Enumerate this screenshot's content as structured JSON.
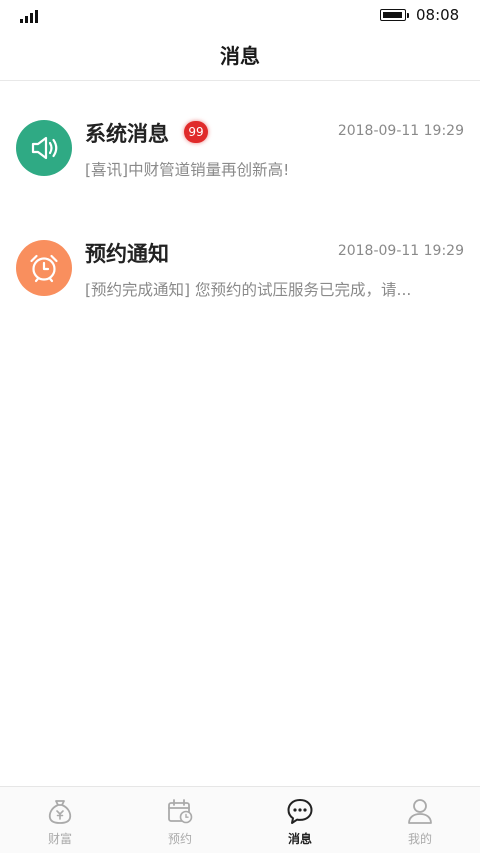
{
  "status_bar": {
    "time": "08:08",
    "signal_icon": "signal-icon",
    "battery_icon": "battery-icon"
  },
  "header": {
    "title": "消息"
  },
  "messages": [
    {
      "title": "系统消息",
      "badge": "99",
      "time": "2018-09-11 19:29",
      "preview": "[喜讯]中财管道销量再创新高!",
      "icon": "speaker-icon",
      "icon_bg": "#2faa84"
    },
    {
      "title": "预约通知",
      "time": "2018-09-11 19:29",
      "preview": "[预约完成通知] 您预约的试压服务已完成，请...",
      "icon": "alarm-clock-icon",
      "icon_bg": "#f98f5e"
    }
  ],
  "tab_bar": {
    "tabs": [
      {
        "label": "财富",
        "icon": "money-bag-icon",
        "active": false
      },
      {
        "label": "预约",
        "icon": "calendar-clock-icon",
        "active": false
      },
      {
        "label": "消息",
        "icon": "chat-bubble-icon",
        "active": true
      },
      {
        "label": "我的",
        "icon": "user-icon",
        "active": false
      }
    ]
  },
  "colors": {
    "badge": "#e02b2b",
    "muted_text": "#8a8a8a",
    "tab_inactive": "#aaaaaa",
    "tab_active": "#222222"
  }
}
